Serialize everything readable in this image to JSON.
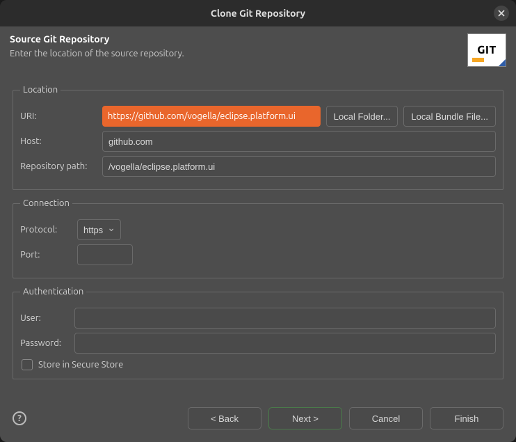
{
  "window": {
    "title": "Clone Git Repository"
  },
  "header": {
    "title": "Source Git Repository",
    "subtitle": "Enter the location of the source repository.",
    "logo_text": "GIT"
  },
  "location": {
    "legend": "Location",
    "uri_label": "URI:",
    "uri_value": "https://github.com/vogella/eclipse.platform.ui",
    "local_folder_btn": "Local Folder...",
    "local_bundle_btn": "Local Bundle File...",
    "host_label": "Host:",
    "host_value": "github.com",
    "repo_path_label": "Repository path:",
    "repo_path_value": "/vogella/eclipse.platform.ui"
  },
  "connection": {
    "legend": "Connection",
    "protocol_label": "Protocol:",
    "protocol_value": "https",
    "port_label": "Port:",
    "port_value": ""
  },
  "authentication": {
    "legend": "Authentication",
    "user_label": "User:",
    "user_value": "",
    "password_label": "Password:",
    "password_value": "",
    "store_label": "Store in Secure Store"
  },
  "footer": {
    "back": "< Back",
    "next": "Next >",
    "cancel": "Cancel",
    "finish": "Finish"
  }
}
